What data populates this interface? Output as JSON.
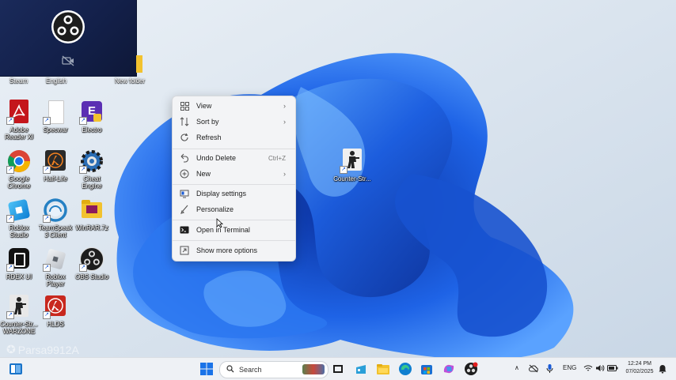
{
  "desktop": {
    "top_row_labels": [
      "Steam",
      "English",
      "New folder"
    ],
    "icons": [
      {
        "name": "adobe-reader",
        "label": "Adobe Reader XI",
        "color": "#c4161c"
      },
      {
        "name": "specwar",
        "label": "Specwar",
        "color": "#ffffff"
      },
      {
        "name": "electro",
        "label": "Electro",
        "color": "#5b2fb3"
      },
      {
        "name": "google-chrome",
        "label": "Google Chrome",
        "color": "#1a73e8"
      },
      {
        "name": "half-life",
        "label": "Half-Life",
        "color": "#f58220"
      },
      {
        "name": "cheat-engine",
        "label": "Cheat Engine",
        "color": "#2a6db5"
      },
      {
        "name": "roblox-studio",
        "label": "Roblox Studio",
        "color": "#1aa3e8"
      },
      {
        "name": "teamspeak",
        "label": "TeamSpeak 3 Client",
        "color": "#2580c3"
      },
      {
        "name": "winrar",
        "label": "WinRAR.7z",
        "color": "#f2c22e"
      },
      {
        "name": "robox-ui",
        "label": "RDEX UI",
        "color": "#111111"
      },
      {
        "name": "roblox-player",
        "label": "Roblox Player",
        "color": "#cfd3d8"
      },
      {
        "name": "obs-studio",
        "label": "OBS Studio",
        "color": "#1d1d1d"
      },
      {
        "name": "counter-strike-warzone",
        "label": "Counter-Str... WARZONE",
        "color": "#3c3c3c"
      },
      {
        "name": "hlds",
        "label": "HLDS",
        "color": "#c8281e"
      }
    ],
    "cs_icon_label": "Counter-Str..."
  },
  "context_menu": {
    "items": [
      {
        "id": "view",
        "label": "View",
        "submenu": "›"
      },
      {
        "id": "sort-by",
        "label": "Sort by",
        "submenu": "›"
      },
      {
        "id": "refresh",
        "label": "Refresh"
      },
      {
        "id": "undo-delete",
        "label": "Undo Delete",
        "shortcut": "Ctrl+Z"
      },
      {
        "id": "new",
        "label": "New",
        "submenu": "›"
      },
      {
        "id": "display-settings",
        "label": "Display settings"
      },
      {
        "id": "personalize",
        "label": "Personalize"
      },
      {
        "id": "open-terminal",
        "label": "Open in Terminal"
      },
      {
        "id": "show-more",
        "label": "Show more options"
      }
    ]
  },
  "watermark": "Parsa9912A",
  "taskbar": {
    "search_placeholder": "Search",
    "language": "ENG",
    "time": "12:24 PM",
    "date": "07/02/2025"
  },
  "colors": {
    "wallpaper_bg": "#dfe8f1",
    "bloom_primary": "#1e63e6",
    "bloom_dark": "#0a2f9c",
    "bloom_light": "#5aa2ff"
  }
}
